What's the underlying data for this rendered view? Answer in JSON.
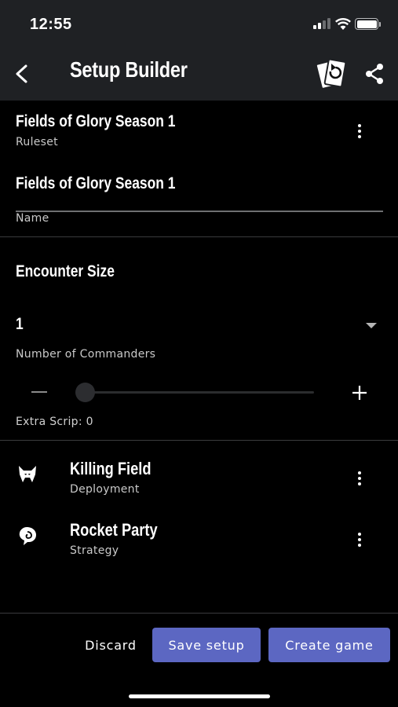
{
  "status_bar": {
    "time": "12:55"
  },
  "app_bar": {
    "title": "Setup Builder"
  },
  "ruleset": {
    "title": "Fields of Glory Season 1",
    "label": "Ruleset"
  },
  "name_field": {
    "value": "Fields of Glory Season 1",
    "label": "Name"
  },
  "encounter": {
    "heading": "Encounter Size",
    "commanders_value": "1",
    "commanders_label": "Number of Commanders",
    "slider_level": 0,
    "extra_scrip": "Extra Scrip: 0"
  },
  "cards": [
    {
      "title": "Killing Field",
      "subtitle": "Deployment",
      "icon": "horned-helmet-icon"
    },
    {
      "title": "Rocket Party",
      "subtitle": "Strategy",
      "icon": "spiral-ear-icon"
    }
  ],
  "actions": {
    "discard": "Discard",
    "save": "Save setup",
    "create": "Create game"
  },
  "colors": {
    "accent": "#5c67c2",
    "app_bar": "#1f2124",
    "background": "#000000"
  }
}
